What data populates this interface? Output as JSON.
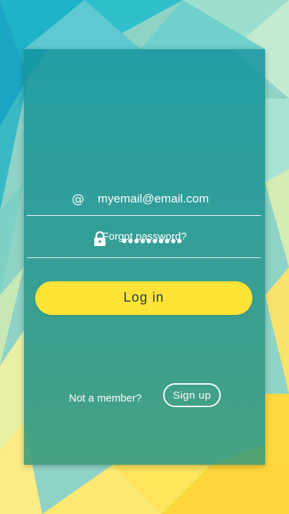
{
  "colors": {
    "accent_button": "#ffe437",
    "card_top": "#1896a0",
    "card_bottom": "#3c9b78",
    "text_light": "#ffffff",
    "button_text": "#2d3b3e"
  },
  "login": {
    "email_icon": "at-icon",
    "email_value": "myemail@email.com",
    "password_icon": "lock-icon",
    "password_value": "••••••••••",
    "forgot_label": "Forgot password?",
    "login_label": "Log in",
    "not_member_label": "Not a member?",
    "signup_label": "Sign up"
  }
}
